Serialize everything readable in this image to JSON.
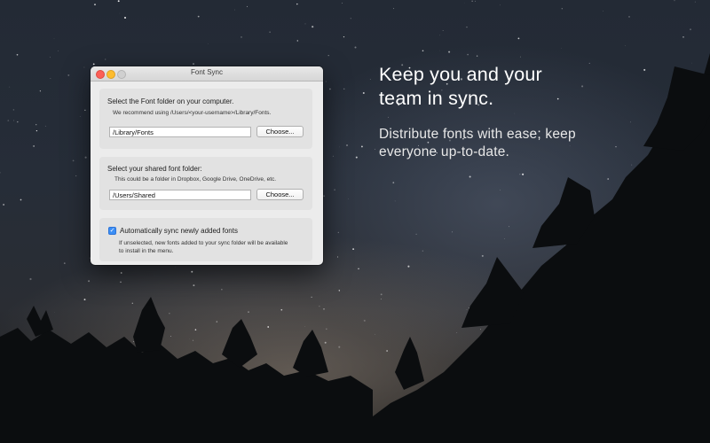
{
  "window": {
    "title": "Font Sync"
  },
  "font_folder": {
    "label": "Select the Font folder on your computer.",
    "hint": "We recommend using /Users/<your-username>/Library/Fonts.",
    "value": "/Library/Fonts",
    "button_label": "Choose..."
  },
  "shared_folder": {
    "label": "Select your shared font folder:",
    "hint": "This could be a folder in Dropbox, Google Drive, OneDrive, etc.",
    "value": "/Users/Shared",
    "button_label": "Choose..."
  },
  "auto_sync": {
    "label": "Automatically sync newly added fonts",
    "checked": true,
    "hint_line1": "If unselected, new fonts added to your sync folder will be available",
    "hint_line2": "to install in the menu."
  },
  "promo": {
    "headline_line1": "Keep you and your",
    "headline_line2": "team in sync.",
    "subline_line1": "Distribute fonts with ease; keep",
    "subline_line2": "everyone up-to-date."
  },
  "colors": {
    "checkbox_accent": "#3b8ef5",
    "close_button": "#fc5f57",
    "minimize_button": "#fdbc2e"
  }
}
